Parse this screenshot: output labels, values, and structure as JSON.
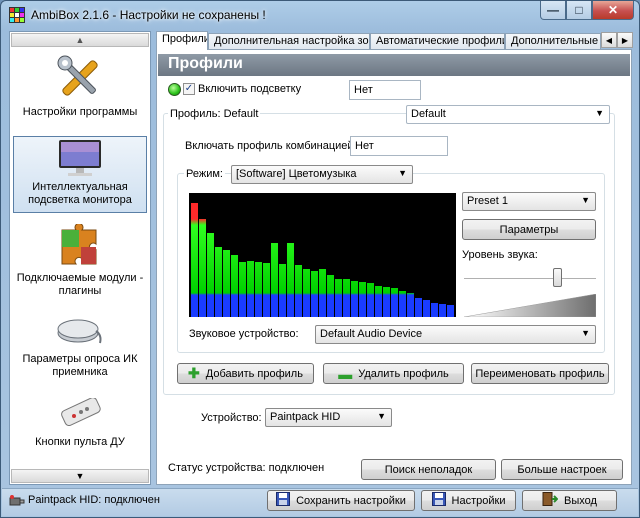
{
  "window": {
    "title": "AmbiBox 2.1.6  - Настройки не сохранены !",
    "minimize_label": "—",
    "maximize_label": "□",
    "close_label": "✕"
  },
  "sidebar": {
    "items": [
      {
        "label": "Настройки программы",
        "icon": "tools-icon"
      },
      {
        "label": "Интеллектуальная подсветка монитора",
        "icon": "monitor-icon"
      },
      {
        "label": "Подключаемые модули - плагины",
        "icon": "puzzle-icon"
      },
      {
        "label": "Параметры опроса ИК приемника",
        "icon": "ir-receiver-icon"
      },
      {
        "label": "Кнопки пульта ДУ",
        "icon": "remote-control-icon"
      }
    ]
  },
  "tabs": [
    "Профили",
    "Дополнительная настройка зон",
    "Автоматические профили",
    "Дополнительные н"
  ],
  "panel": {
    "title": "Профили",
    "enable_label": "Включить подсветку",
    "enable_hotkey": "Нет",
    "profile_label": "Профиль: Default",
    "profile_value": "Default",
    "combo_label": "Включать профиль комбинацией:",
    "combo_hotkey": "Нет",
    "mode_label": "Режим:",
    "mode_value": "[Software] Цветомузыка",
    "preset_value": "Preset 1",
    "params_button": "Параметры",
    "volume_label": "Уровень звука:",
    "sound_device_label": "Звуковое устройство:",
    "sound_device_value": "Default Audio Device",
    "add_profile": "Добавить профиль",
    "delete_profile": "Удалить профиль",
    "rename_profile": "Переименовать профиль",
    "device_label": "Устройство:",
    "device_value": "Paintpack HID",
    "device_status": "Статус устройства: подключен",
    "troubleshoot_button": "Поиск неполадок",
    "more_settings_button": "Больше настроек"
  },
  "spectrum": {
    "volume_level": 0.72,
    "levels": [
      0.95,
      0.82,
      0.7,
      0.58,
      0.56,
      0.52,
      0.46,
      0.47,
      0.46,
      0.45,
      0.62,
      0.44,
      0.62,
      0.43,
      0.4,
      0.38,
      0.4,
      0.35,
      0.32,
      0.32,
      0.3,
      0.29,
      0.28,
      0.26,
      0.25,
      0.24,
      0.22,
      0.2,
      0.16,
      0.14,
      0.12,
      0.11,
      0.1
    ]
  },
  "statusbar": {
    "device_status": "Paintpack HID: подключен",
    "save_button": "Сохранить настройки",
    "settings_button": "Настройки",
    "exit_button": "Выход"
  }
}
